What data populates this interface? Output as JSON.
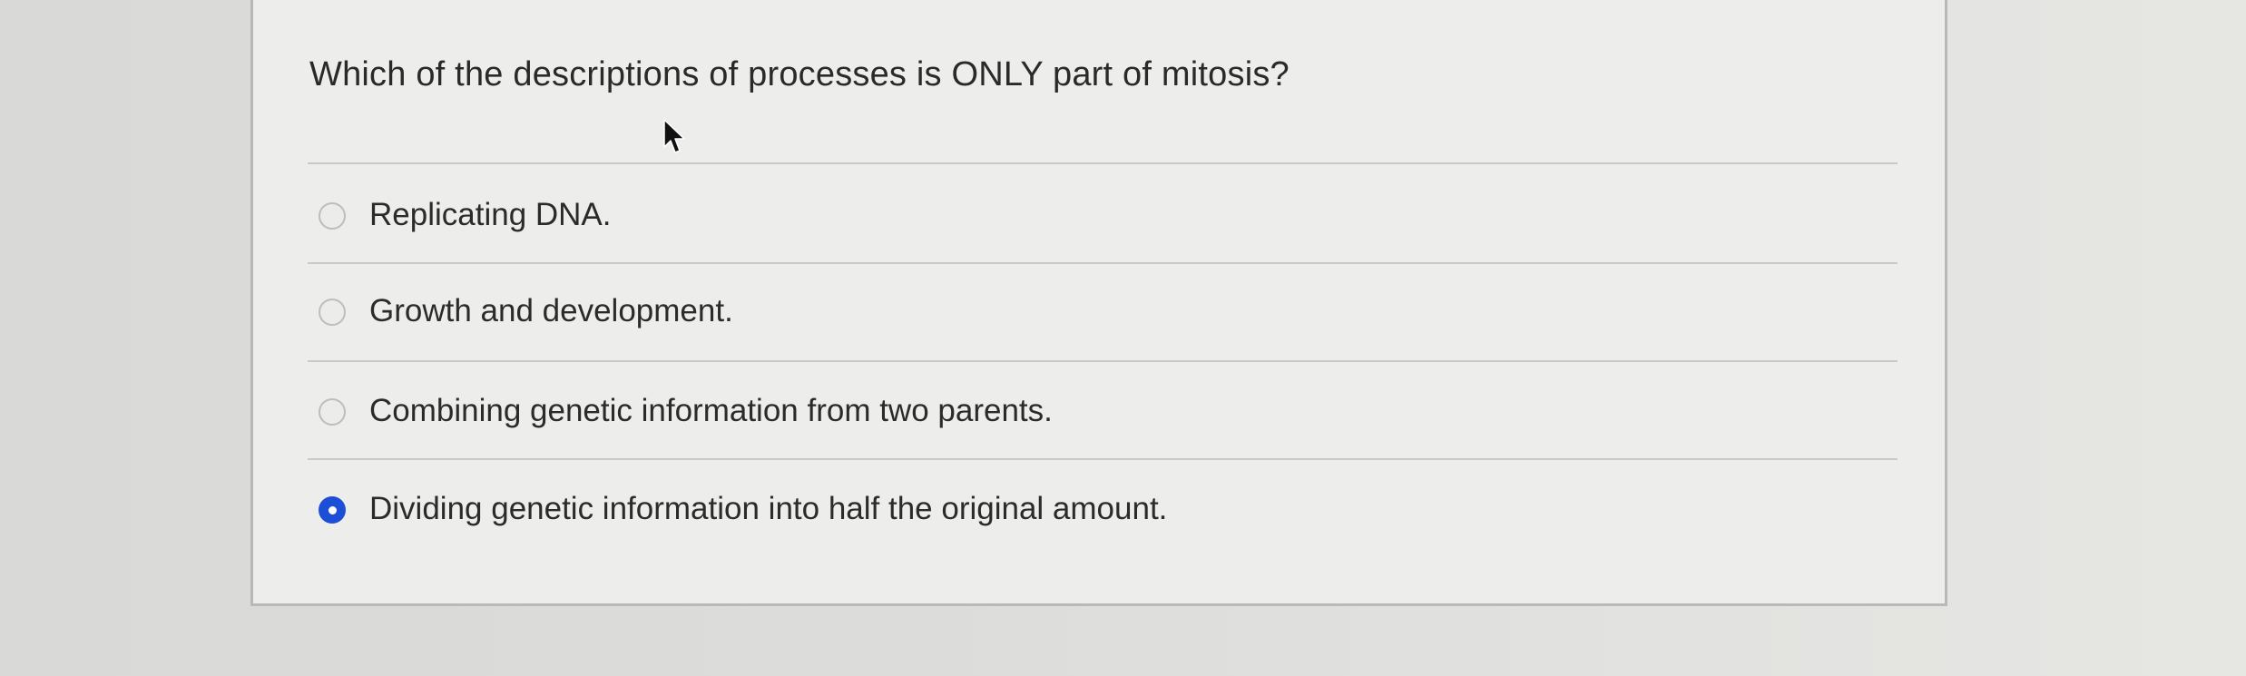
{
  "question": {
    "text": "Which of the descriptions of processes is ONLY part of mitosis?"
  },
  "options": [
    {
      "label": "Replicating DNA.",
      "selected": false
    },
    {
      "label": "Growth and development.",
      "selected": false
    },
    {
      "label": "Combining genetic information from two parents.",
      "selected": false
    },
    {
      "label": "Dividing genetic information into half the original amount.",
      "selected": true
    }
  ],
  "colors": {
    "selected_radio": "#1d4fd6",
    "text": "#2b2b2b",
    "card_border": "#b9b9b7"
  },
  "icons": {
    "cursor": "mouse-pointer-icon"
  }
}
